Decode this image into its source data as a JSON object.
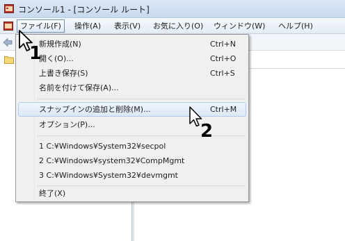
{
  "window": {
    "title": "コンソール1 - [コンソール ルート]"
  },
  "menubar": {
    "items": [
      {
        "label": "ファイル(F)",
        "active": true
      },
      {
        "label": "操作(A)"
      },
      {
        "label": "表示(V)"
      },
      {
        "label": "お気に入り(O)"
      },
      {
        "label": "ウィンドウ(W)"
      },
      {
        "label": "ヘルプ(H)"
      }
    ]
  },
  "file_menu": {
    "items": [
      {
        "label": "新規作成(N)",
        "shortcut": "Ctrl+N"
      },
      {
        "label": "開く(O)...",
        "shortcut": "Ctrl+O"
      },
      {
        "label": "上書き保存(S)",
        "shortcut": "Ctrl+S"
      },
      {
        "label": "名前を付けて保存(A)...",
        "shortcut": ""
      },
      {
        "label": "スナップインの追加と削除(M)...",
        "shortcut": "Ctrl+M",
        "highlighted": true
      },
      {
        "label": "オプション(P)...",
        "shortcut": ""
      },
      {
        "label": "1 C:¥Windows¥System32¥secpol",
        "shortcut": ""
      },
      {
        "label": "2 C:¥Windows¥system32¥CompMgmt",
        "shortcut": ""
      },
      {
        "label": "3 C:¥Windows¥System32¥devmgmt",
        "shortcut": ""
      },
      {
        "label": "終了(X)",
        "shortcut": ""
      }
    ]
  },
  "annotations": {
    "step1": "1",
    "step2": "2"
  },
  "colors": {
    "titlebar": "#c9daee",
    "menu_bg": "#f0f0f0",
    "highlight_border": "#aecaf0",
    "active_menu_border": "#6d8fb8"
  },
  "icons": [
    "mmc-console-icon",
    "back-arrow-icon",
    "folder-icon",
    "mouse-cursor-icon"
  ]
}
